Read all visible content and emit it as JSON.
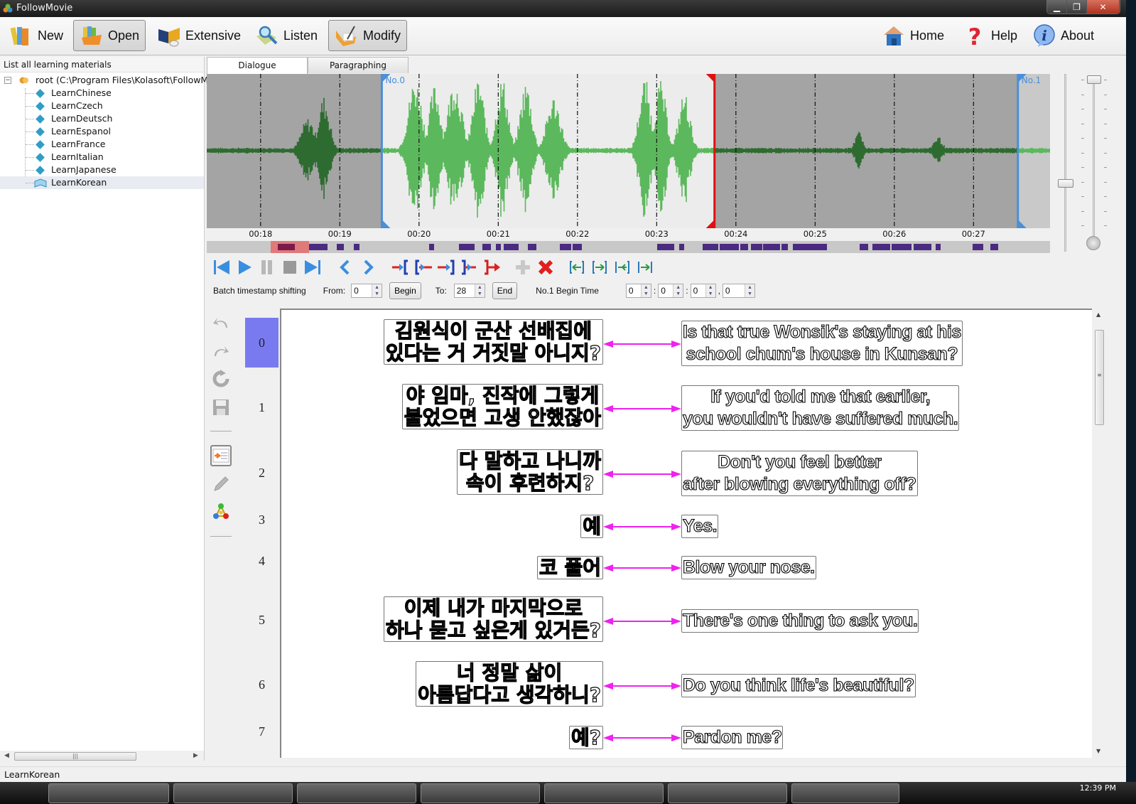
{
  "window": {
    "title": "FollowMovie",
    "controls": {
      "minimize": "▁",
      "restore": "❐",
      "close": "✕"
    }
  },
  "toolbar": {
    "left": [
      {
        "id": "new",
        "label": "New",
        "icon": "books-icon",
        "active": false
      },
      {
        "id": "open",
        "label": "Open",
        "icon": "open-books-icon",
        "active": true
      },
      {
        "id": "extensive",
        "label": "Extensive",
        "icon": "book-coffee-icon",
        "active": false
      },
      {
        "id": "listen",
        "label": "Listen",
        "icon": "magnifier-book-icon",
        "active": false
      },
      {
        "id": "modify",
        "label": "Modify",
        "icon": "folder-pencil-icon",
        "active": true
      }
    ],
    "right": [
      {
        "id": "home",
        "label": "Home",
        "icon": "home-icon"
      },
      {
        "id": "help",
        "label": "Help",
        "icon": "question-icon"
      },
      {
        "id": "about",
        "label": "About",
        "icon": "info-icon"
      }
    ]
  },
  "sidebar": {
    "header": "List all learning materials",
    "root_label": "root (C:\\Program Files\\Kolasoft\\FollowMovie",
    "items": [
      {
        "label": "LearnChinese",
        "selected": false
      },
      {
        "label": "LearnCzech",
        "selected": false
      },
      {
        "label": "LearnDeutsch",
        "selected": false
      },
      {
        "label": "LearnEspanol",
        "selected": false
      },
      {
        "label": "LearnFrance",
        "selected": false
      },
      {
        "label": "LearnItalian",
        "selected": false
      },
      {
        "label": "LearnJapanese",
        "selected": false
      },
      {
        "label": "LearnKorean",
        "selected": true
      }
    ]
  },
  "tabs": [
    {
      "label": "Dialogue",
      "active": true
    },
    {
      "label": "Paragraphing",
      "active": false
    }
  ],
  "waveform": {
    "time_ticks": [
      "00:18",
      "00:19",
      "00:20",
      "00:21",
      "00:22",
      "00:23",
      "00:24",
      "00:25",
      "00:26",
      "00:27"
    ],
    "markers": [
      {
        "label": "No.0",
        "color": "#4a8fd8"
      },
      {
        "label": "No.1",
        "color": "#4a8fd8"
      }
    ],
    "playhead_color": "#e01010",
    "wave_color_active": "#5cb85c",
    "wave_color_inactive": "#2e6b30"
  },
  "controls": {
    "playback": [
      "skip-start-icon",
      "play-icon",
      "pause-icon",
      "stop-icon",
      "skip-end-icon"
    ],
    "navigation": [
      "prev-icon",
      "next-icon"
    ],
    "boundary": [
      "set-begin-icon",
      "move-begin-icon",
      "set-end-icon",
      "move-end-icon",
      "extend-end-icon"
    ],
    "edit": [
      "add-icon",
      "delete-icon"
    ],
    "adjust": [
      "shift-begin-left-icon",
      "shift-begin-right-icon",
      "shift-end-left-icon",
      "shift-end-right-icon"
    ]
  },
  "batch": {
    "label": "Batch timestamp shifting",
    "from_label": "From:",
    "from_value": "0",
    "begin_button": "Begin",
    "to_label": "To:",
    "to_value": "28",
    "end_button": "End",
    "time_label": "No.1 Begin Time",
    "time_h": "0",
    "time_m": "0",
    "time_s": "0",
    "time_ms": "0"
  },
  "dialogue": [
    {
      "index": "0",
      "selected": true,
      "korean": [
        "김원식이 군산 선배집에",
        "있다는 거 거짓말 아니지?"
      ],
      "english": [
        "Is that true Wonsik's staying at his",
        "school chum's house in Kunsan?"
      ]
    },
    {
      "index": "1",
      "selected": false,
      "korean": [
        "야 임마, 진작에 그렇게",
        "불었으면 고생 안했잖아"
      ],
      "english": [
        "If you'd told me that earlier,",
        "you wouldn't have suffered much."
      ]
    },
    {
      "index": "2",
      "selected": false,
      "korean": [
        "다 말하고 나니까",
        "속이 후련하지?"
      ],
      "english": [
        "Don't you feel better",
        "after blowing everything off?"
      ]
    },
    {
      "index": "3",
      "selected": false,
      "korean": [
        "예"
      ],
      "english": [
        "Yes."
      ]
    },
    {
      "index": "4",
      "selected": false,
      "korean": [
        "코 풀어"
      ],
      "english": [
        "Blow your nose."
      ]
    },
    {
      "index": "5",
      "selected": false,
      "korean": [
        "이제 내가 마지막으로",
        "하나 묻고 싶은게 있거든?"
      ],
      "english": [
        "There's one thing to ask you."
      ]
    },
    {
      "index": "6",
      "selected": false,
      "korean": [
        "너 정말 삶이",
        "아름답다고 생각하니?"
      ],
      "english": [
        "Do you think life's beautiful?"
      ]
    },
    {
      "index": "7",
      "selected": false,
      "korean": [
        "예?"
      ],
      "english": [
        "Pardon me?"
      ]
    }
  ],
  "status": {
    "text": "LearnKorean"
  },
  "taskbar": {
    "clock": "12:39 PM"
  },
  "colors": {
    "link_arrow": "#ee22ee",
    "selected_row": "#7a7af0"
  }
}
